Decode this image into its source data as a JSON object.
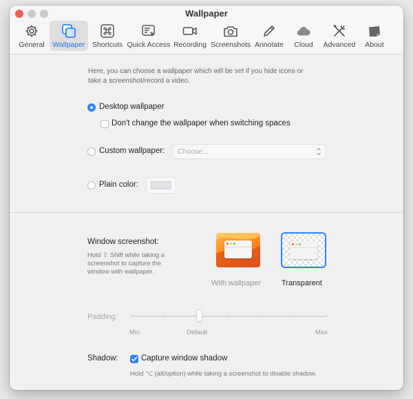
{
  "window": {
    "title": "Wallpaper"
  },
  "tabs": [
    {
      "label": "General",
      "icon": "gear-icon"
    },
    {
      "label": "Wallpaper",
      "icon": "wallpaper-icon",
      "active": true
    },
    {
      "label": "Shortcuts",
      "icon": "command-key-icon"
    },
    {
      "label": "Quick Access",
      "icon": "quick-access-icon"
    },
    {
      "label": "Recording",
      "icon": "video-camera-icon"
    },
    {
      "label": "Screenshots",
      "icon": "camera-icon"
    },
    {
      "label": "Annotate",
      "icon": "pencil-icon"
    },
    {
      "label": "Cloud",
      "icon": "cloud-icon"
    },
    {
      "label": "Advanced",
      "icon": "tools-icon"
    },
    {
      "label": "About",
      "icon": "about-icon"
    }
  ],
  "wallpaper": {
    "intro": "Here, you can choose a wallpaper which will be set if you hide icons or take a screenshot/record a video.",
    "desktop_label": "Desktop wallpaper",
    "desktop_selected": true,
    "dont_change_label": "Don't change the wallpaper when switching spaces",
    "dont_change_checked": false,
    "custom_label": "Custom wallpaper:",
    "custom_placeholder": "Choose...",
    "plain_label": "Plain color:",
    "plain_color": "#dfe3e8"
  },
  "window_screenshot": {
    "title": "Window screenshot:",
    "hint": "Hold ⇧ Shift while taking a screenshot to capture the window with wallpaper.",
    "option_with_wallpaper": "With wallpaper",
    "option_transparent": "Transparent",
    "selected": "Transparent",
    "padding_label": "Padding:",
    "padding_min": "Min",
    "padding_default": "Default",
    "padding_max": "Max",
    "padding_value": 0.35
  },
  "shadow": {
    "label": "Shadow:",
    "capture_label": "Capture window shadow",
    "capture_checked": true,
    "hint": "Hold ⌥ (alt/option) while taking a screenshot to disable shadow."
  },
  "colors": {
    "accent": "#2e83f3",
    "close": "#ee5f57"
  }
}
